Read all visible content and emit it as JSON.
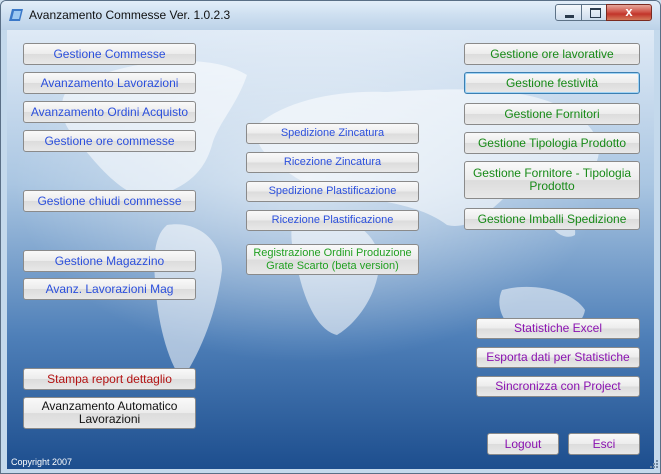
{
  "window": {
    "title": "Avanzamento Commesse Ver. 1.0.2.3",
    "close_glyph": "x"
  },
  "left_buttons": {
    "gestione_commesse": "Gestione Commesse",
    "avanzamento_lavorazioni": "Avanzamento Lavorazioni",
    "avanzamento_ordini_acquisto": "Avanzamento Ordini Acquisto",
    "gestione_ore_commesse": "Gestione ore commesse",
    "gestione_chiudi_commesse": "Gestione chiudi commesse",
    "gestione_magazzino": "Gestione Magazzino",
    "avanz_lavorazioni_mag": "Avanz. Lavorazioni Mag",
    "stampa_report_dettaglio": "Stampa report dettaglio",
    "avanzamento_automatico": "Avanzamento Automatico Lavorazioni"
  },
  "middle_buttons": {
    "spedizione_zincatura": "Spedizione Zincatura",
    "ricezione_zincatura": "Ricezione Zincatura",
    "spedizione_plastificazione": "Spedizione Plastificazione",
    "ricezione_plastificazione": "Ricezione Plastificazione",
    "registrazione_ordini": "Registrazione Ordini Produzione Grate Scarto (beta version)"
  },
  "right_buttons": {
    "gestione_ore_lavorative": "Gestione ore lavorative",
    "gestione_festivita": "Gestione festività",
    "gestione_fornitori": "Gestione Fornitori",
    "gestione_tipologia_prodotto": "Gestione Tipologia Prodotto",
    "gestione_fornitore_tipologia": "Gestione Fornitore - Tipologia Prodotto",
    "gestione_imballi_spedizione": "Gestione Imballi Spedizione",
    "statistiche_excel": "Statistiche Excel",
    "esporta_dati": "Esporta dati per Statistiche",
    "sincronizza_project": "Sincronizza con Project",
    "logout": "Logout",
    "esci": "Esci"
  },
  "footer": {
    "copyright": "Copyright 2007"
  },
  "colors": {
    "blue_text": "#2b4fdc",
    "green_text": "#178a17",
    "purple_text": "#8a12b0",
    "red_text": "#b31212"
  }
}
